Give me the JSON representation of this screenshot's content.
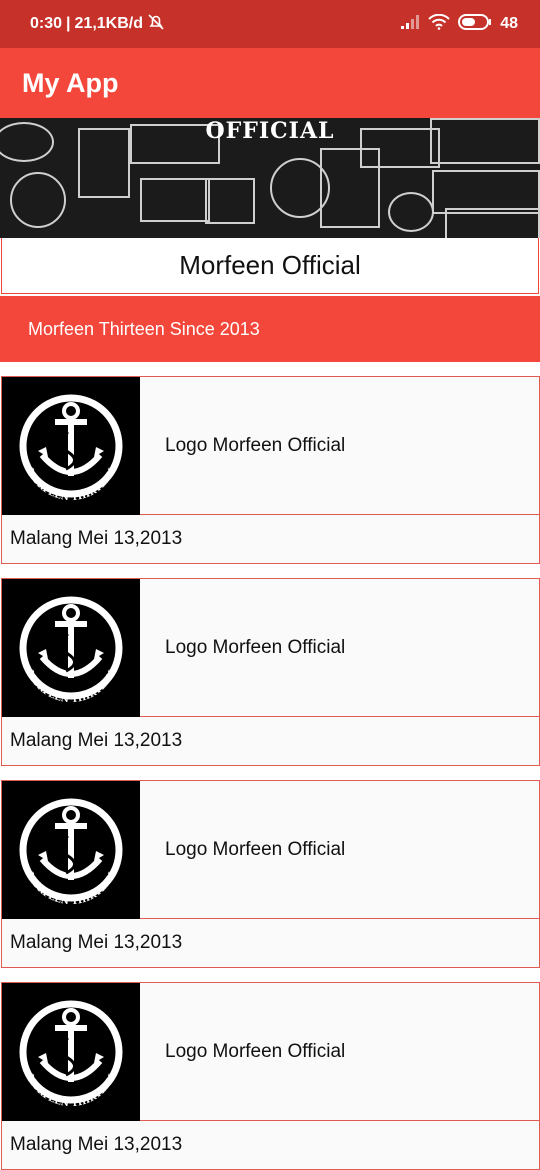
{
  "status_bar": {
    "time": "0:30",
    "network_speed": "21,1KB/d",
    "battery": "48",
    "icons": [
      "alarm-off-icon",
      "signal-icon",
      "wifi-icon",
      "battery-icon"
    ]
  },
  "app_bar": {
    "title": "My App"
  },
  "banner": {
    "label": "OFFICIAL"
  },
  "header": {
    "title": "Morfeen Official",
    "subtitle": "Morfeen Thirteen Since 2013"
  },
  "list": {
    "items": [
      {
        "name": "Logo Morfeen Official",
        "date": "Malang Mei 13,2013"
      },
      {
        "name": "Logo Morfeen Official",
        "date": "Malang Mei 13,2013"
      },
      {
        "name": "Logo Morfeen Official",
        "date": "Malang Mei 13,2013"
      },
      {
        "name": "Logo Morfeen Official",
        "date": "Malang Mei 13,2013"
      }
    ]
  },
  "logo_text": "MORFEEN THIRTEEN",
  "colors": {
    "accent": "#f4473b",
    "status_bar": "#c63129",
    "card_border": "#e05c52"
  }
}
